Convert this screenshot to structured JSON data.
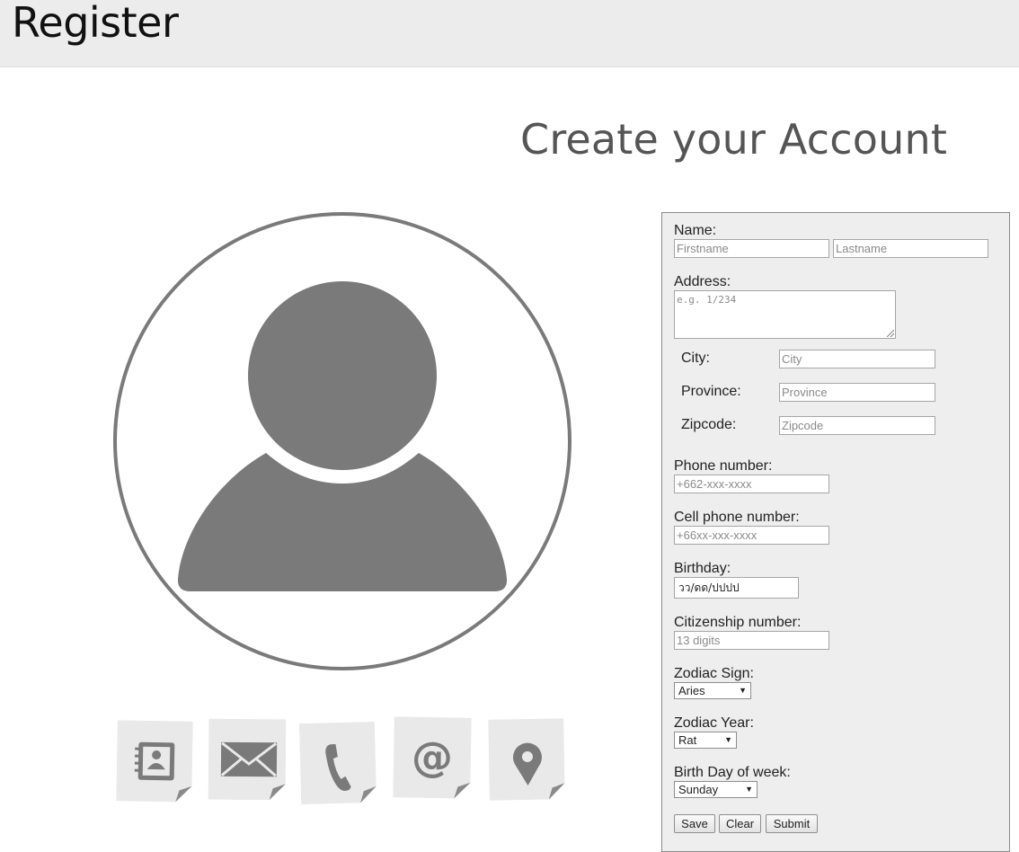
{
  "header": {
    "title": "Register"
  },
  "page": {
    "title": "Create your Account"
  },
  "icons": [
    "contacts-book-icon",
    "envelope-icon",
    "phone-icon",
    "at-sign-icon",
    "map-pin-icon"
  ],
  "colors": {
    "accent_gray": "#7a7a7a",
    "panel_bg": "#eeeeee",
    "header_bg": "#ececec"
  },
  "form": {
    "name": {
      "label": "Name:",
      "first_placeholder": "Firstname",
      "last_placeholder": "Lastname"
    },
    "address": {
      "label": "Address:",
      "placeholder": "e.g. 1/234"
    },
    "city": {
      "label": "City:",
      "placeholder": "City"
    },
    "province": {
      "label": "Province:",
      "placeholder": "Province"
    },
    "zipcode": {
      "label": "Zipcode:",
      "placeholder": "Zipcode"
    },
    "phone": {
      "label": "Phone number:",
      "placeholder": "+662-xxx-xxxx"
    },
    "cell": {
      "label": "Cell phone number:",
      "placeholder": "+66xx-xxx-xxxx"
    },
    "birthday": {
      "label": "Birthday:",
      "value": "วว/ดด/ปปปป"
    },
    "citizen": {
      "label": "Citizenship number:",
      "placeholder": "13 digits"
    },
    "zodiac_sign": {
      "label": "Zodiac Sign:",
      "selected": "Aries"
    },
    "zodiac_year": {
      "label": "Zodiac Year:",
      "selected": "Rat"
    },
    "birth_day": {
      "label": "Birth Day of week:",
      "selected": "Sunday"
    },
    "buttons": {
      "save": "Save",
      "clear": "Clear",
      "submit": "Submit"
    }
  }
}
